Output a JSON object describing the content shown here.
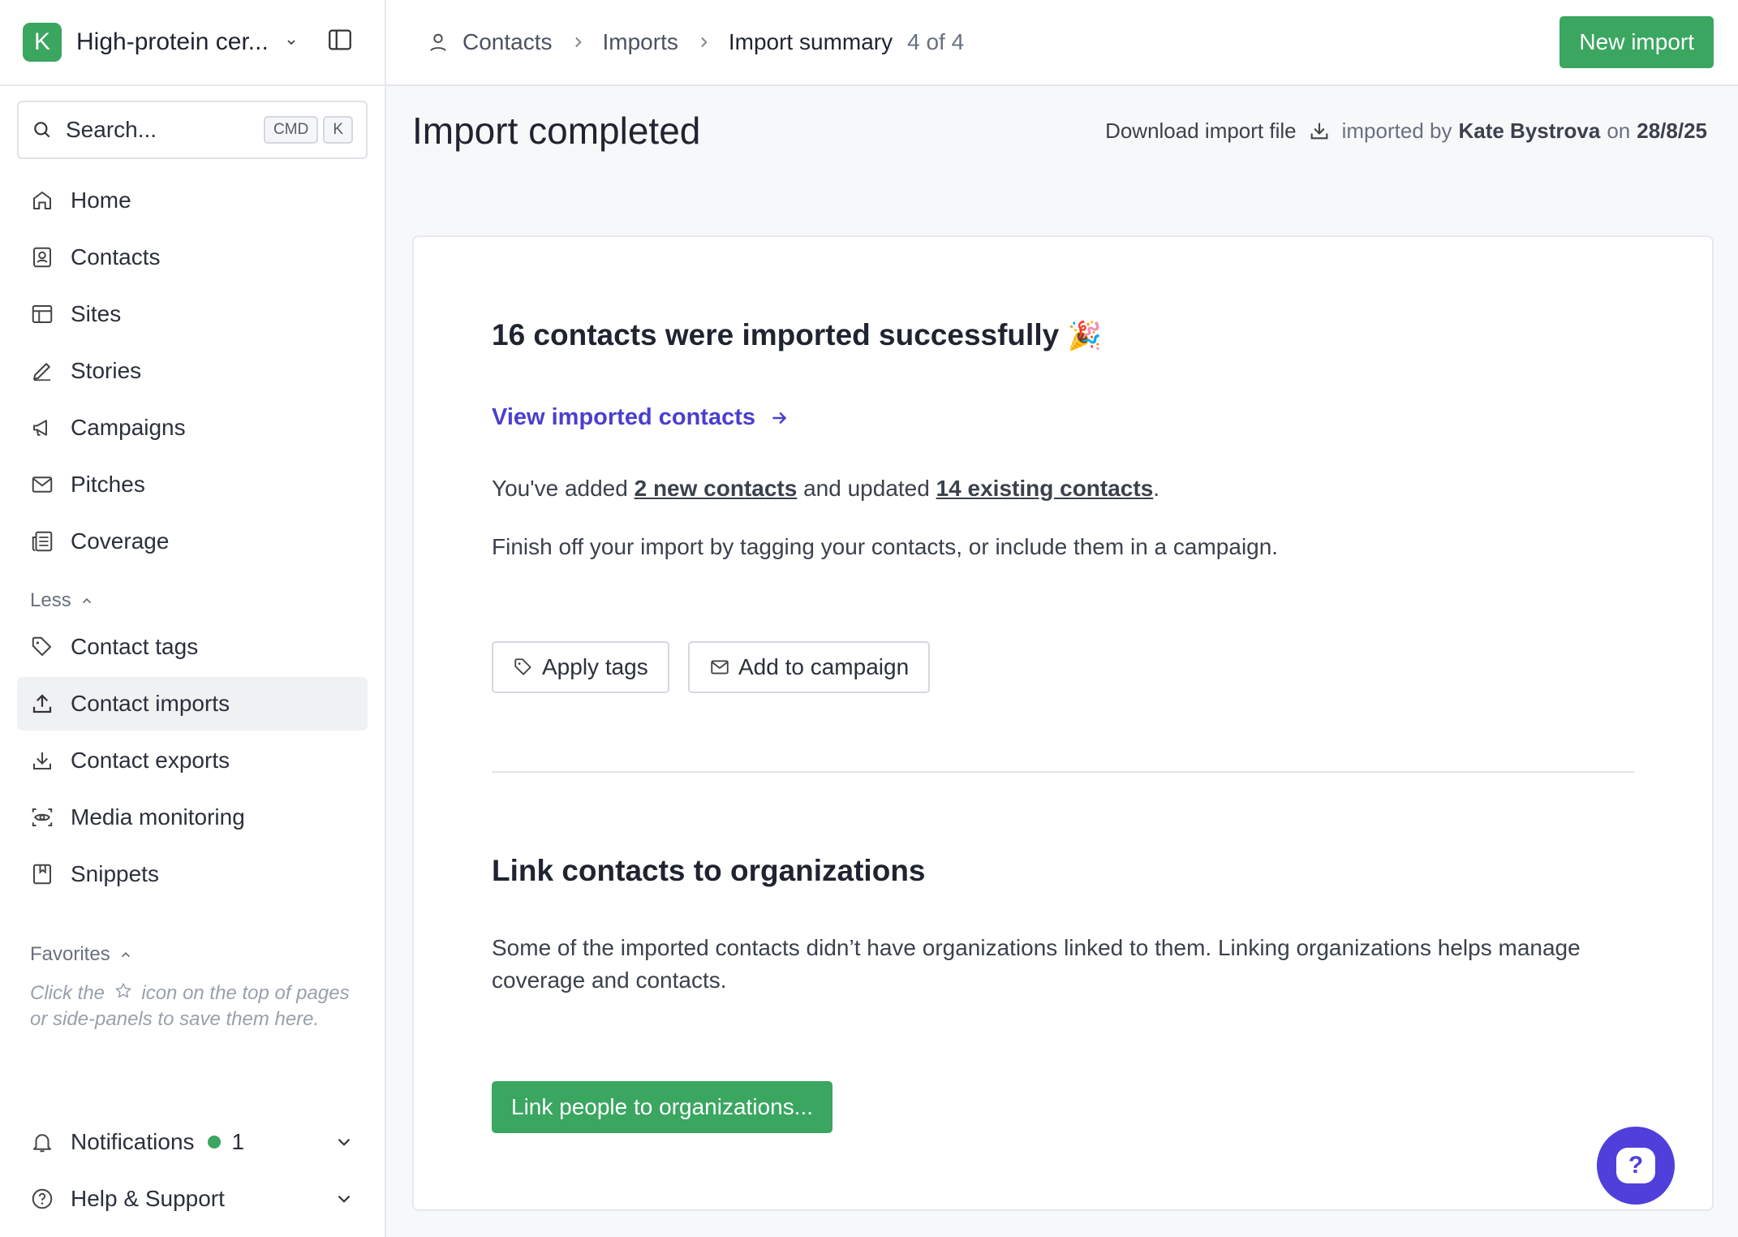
{
  "workspace": {
    "initial": "K",
    "name": "High-protein cer..."
  },
  "search": {
    "placeholder": "Search...",
    "kbd_cmd": "CMD",
    "kbd_k": "K"
  },
  "nav": {
    "items": [
      {
        "label": "Home",
        "icon": "home-icon"
      },
      {
        "label": "Contacts",
        "icon": "contact-card-icon"
      },
      {
        "label": "Sites",
        "icon": "layout-icon"
      },
      {
        "label": "Stories",
        "icon": "pen-icon"
      },
      {
        "label": "Campaigns",
        "icon": "megaphone-icon"
      },
      {
        "label": "Pitches",
        "icon": "mail-icon"
      },
      {
        "label": "Coverage",
        "icon": "newspaper-icon"
      }
    ],
    "less_label": "Less",
    "more_items": [
      {
        "label": "Contact tags",
        "icon": "tag-icon"
      },
      {
        "label": "Contact imports",
        "icon": "upload-icon",
        "active": true
      },
      {
        "label": "Contact exports",
        "icon": "download-icon"
      },
      {
        "label": "Media monitoring",
        "icon": "eye-scan-icon"
      },
      {
        "label": "Snippets",
        "icon": "bookmark-icon"
      }
    ],
    "favorites_label": "Favorites",
    "favorites_hint_before": "Click the",
    "favorites_hint_after": "icon on the top of pages or side-panels to save them here."
  },
  "bottom": {
    "notifications_label": "Notifications",
    "notifications_count": "1",
    "help_label": "Help & Support"
  },
  "breadcrumb": {
    "contacts": "Contacts",
    "imports": "Imports",
    "current": "Import summary",
    "step": "4 of 4"
  },
  "topbar": {
    "new_import": "New import"
  },
  "page": {
    "title": "Import completed",
    "download_label": "Download import file",
    "imported_by_prefix": "imported by",
    "imported_by_name": "Kate Bystrova",
    "on_word": "on",
    "date": "28/8/25"
  },
  "summary": {
    "heading": "16 contacts were imported successfully",
    "emoji": "🎉",
    "view_link": "View imported contacts",
    "added_prefix": "You've added",
    "new_contacts_link": "2 new contacts",
    "updated_word": "and updated",
    "existing_contacts_link": "14 existing contacts",
    "period": ".",
    "finish_text": "Finish off your import by tagging your contacts, or include them in a campaign.",
    "apply_tags": "Apply tags",
    "add_to_campaign": "Add to campaign"
  },
  "link_section": {
    "heading": "Link contacts to organizations",
    "body": "Some of the imported contacts didn’t have organizations linked to them. Linking organizations helps manage coverage and contacts.",
    "button": "Link people to organizations..."
  },
  "help_fab": {
    "symbol": "?"
  },
  "colors": {
    "brand_green": "#3aa660",
    "link_purple": "#4a3fcf",
    "fab_purple": "#4f3fdb"
  }
}
